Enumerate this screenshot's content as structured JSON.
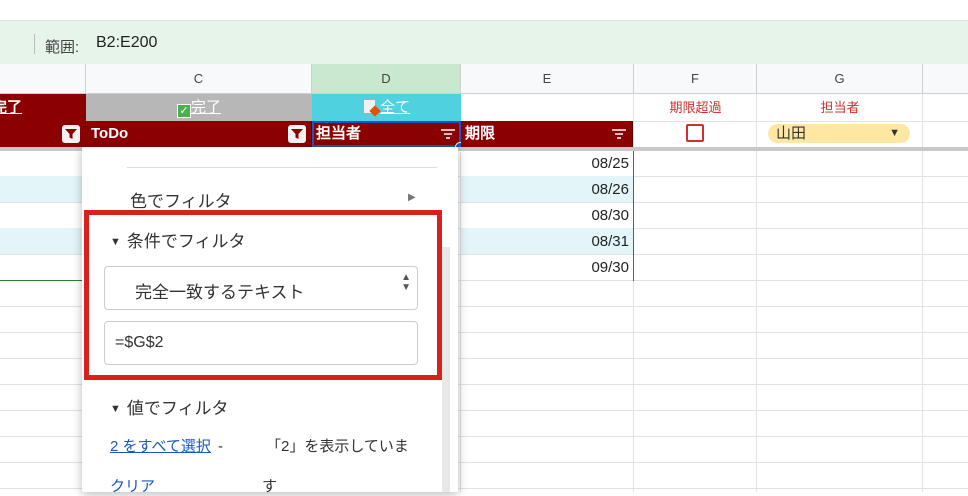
{
  "range_bar": {
    "label": "範囲:",
    "value": "B2:E200"
  },
  "columns": [
    "C",
    "D",
    "E",
    "F",
    "G"
  ],
  "row1": {
    "b_label": "完了",
    "c_label": "完了",
    "d_label": "全て",
    "f_label": "期限超過",
    "g_label": "担当者"
  },
  "row2": {
    "c_header": "ToDo",
    "d_header": "担当者",
    "e_header": "期限",
    "g_dropdown_value": "山田"
  },
  "dates": [
    "08/25",
    "08/26",
    "08/30",
    "08/31",
    "09/30"
  ],
  "popup": {
    "color_filter": "色でフィルタ",
    "condition_filter": "条件でフィルタ",
    "condition_select": "完全一致するテキスト",
    "condition_value": "=$G$2",
    "value_filter": "値でフィルタ",
    "select_all": "2 をすべて選択",
    "dash": "-",
    "showing_text_1": "「2」を表示していま",
    "clear": "クリア",
    "showing_text_2": "す"
  },
  "colors": {
    "header_red": "#8b0000",
    "range_bar_bg": "#e6f4ea",
    "highlight_box": "#d8201c",
    "row1_c_bg": "#b7b7b7",
    "row1_d_bg": "#4fd1e0",
    "dropdown_chip": "#fde7a3"
  }
}
